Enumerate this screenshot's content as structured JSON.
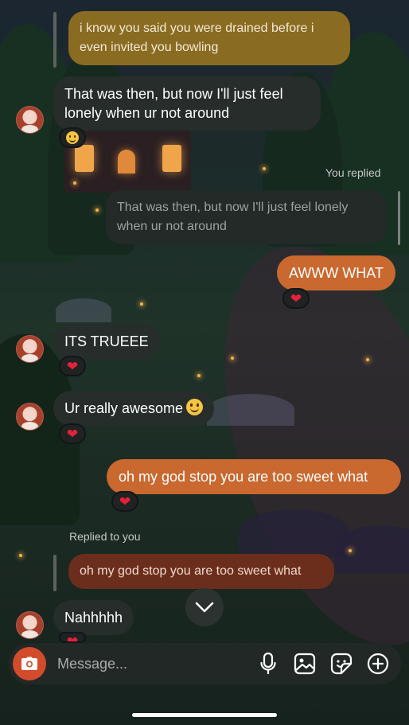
{
  "colors": {
    "outgoing_bubble": "#c9682f",
    "incoming_bubble": "#262d2b",
    "gold_quote": "#8a6b22",
    "rust_quote": "#6b2e1c",
    "heart": "#e8213b",
    "camera_button": "#d24b2b"
  },
  "messages": {
    "quote_top": "i know you said you were drained before i even invited you bowling",
    "m1": "That was then, but now I'll just feel lonely when ur not around",
    "m1_reaction": "smile-emoji",
    "you_replied_label": "You replied",
    "quote_mid": "That was then, but now I'll just feel lonely when ur not around",
    "m2": "AWWW WHAT",
    "m2_reaction": "heart-emoji",
    "m3": "ITS TRUEEE",
    "m3_reaction": "heart-emoji",
    "m4": "Ur really awesome",
    "m4_emoji": "smile-emoji",
    "m4_reaction": "heart-emoji",
    "m5": "oh my god stop you are too sweet what",
    "m5_reaction": "heart-emoji",
    "replied_to_you_label": "Replied to you",
    "quote_bottom": "oh my god stop you are too sweet what",
    "m6": "Nahhhhh",
    "m6_reaction": "heart-emoji"
  },
  "composer": {
    "placeholder": "Message...",
    "icons": [
      "camera-icon",
      "microphone-icon",
      "gallery-icon",
      "sticker-icon",
      "add-icon"
    ]
  }
}
